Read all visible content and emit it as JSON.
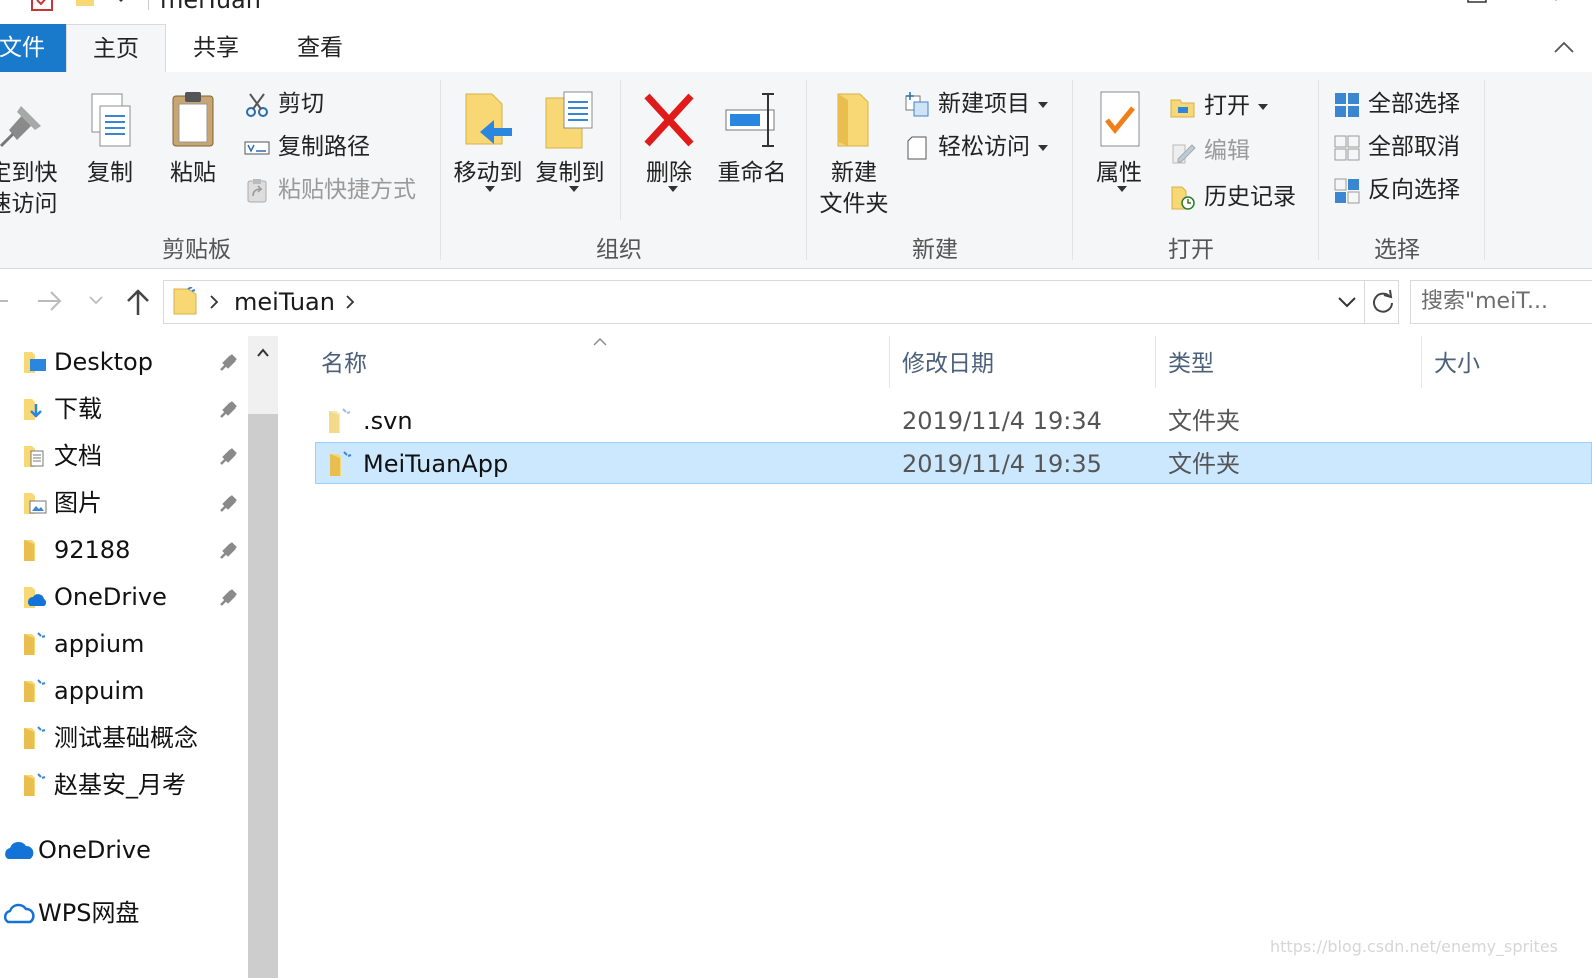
{
  "window": {
    "title": "meiTuan"
  },
  "tabs": [
    {
      "label": "文件"
    },
    {
      "label": "主页"
    },
    {
      "label": "共享"
    },
    {
      "label": "查看"
    }
  ],
  "ribbon": {
    "clipboard": {
      "label": "剪贴板",
      "pin_quick": "定到快\n速访问",
      "copy": "复制",
      "paste": "粘贴",
      "cut": "剪切",
      "copy_path": "复制路径",
      "paste_shortcut": "粘贴快捷方式"
    },
    "organize": {
      "label": "组织",
      "move_to": "移动到",
      "copy_to": "复制到",
      "delete": "删除",
      "rename": "重命名"
    },
    "new": {
      "label": "新建",
      "new_folder": "新建\n文件夹",
      "new_item": "新建项目",
      "easy_access": "轻松访问"
    },
    "open": {
      "label": "打开",
      "properties": "属性",
      "open": "打开",
      "edit": "编辑",
      "history": "历史记录"
    },
    "select": {
      "label": "选择",
      "select_all": "全部选择",
      "select_none": "全部取消",
      "invert": "反向选择"
    }
  },
  "address": {
    "segment": "meiTuan"
  },
  "search": {
    "placeholder": "搜索\"meiT..."
  },
  "navpane": {
    "quick": [
      {
        "label": "Desktop",
        "pinned": true
      },
      {
        "label": "下载",
        "pinned": true
      },
      {
        "label": "文档",
        "pinned": true
      },
      {
        "label": "图片",
        "pinned": true
      },
      {
        "label": "92188",
        "pinned": true
      },
      {
        "label": "OneDrive",
        "pinned": true
      },
      {
        "label": "appium",
        "pinned": false
      },
      {
        "label": "appuim",
        "pinned": false
      },
      {
        "label": "测试基础概念",
        "pinned": false
      },
      {
        "label": "赵基安_月考",
        "pinned": false
      }
    ],
    "onedrive": "OneDrive",
    "wps": "WPS网盘"
  },
  "columns": {
    "name": "名称",
    "modified": "修改日期",
    "type": "类型",
    "size": "大小"
  },
  "files": [
    {
      "name": ".svn",
      "modified": "2019/11/4 19:34",
      "type": "文件夹",
      "selected": false
    },
    {
      "name": "MeiTuanApp",
      "modified": "2019/11/4 19:35",
      "type": "文件夹",
      "selected": true
    }
  ],
  "watermark": "https://blog.csdn.net/enemy_sprites",
  "colors": {
    "accent": "#1979ca",
    "selection": "#cce8ff",
    "selection_border": "#99d1ff",
    "folder": "#f8d775"
  }
}
